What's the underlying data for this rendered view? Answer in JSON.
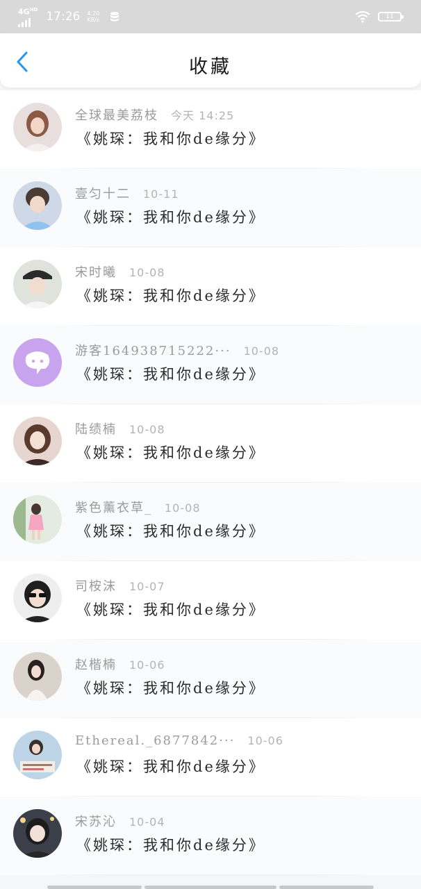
{
  "status_bar": {
    "network": "4G",
    "network_sup": "HD",
    "time": "17:26",
    "speed_value": "4.20",
    "speed_unit": "KB/s",
    "battery_text": "11"
  },
  "header": {
    "title": "收藏",
    "back_icon": "chevron-left-icon"
  },
  "favorites": [
    {
      "name": "全球最美荔枝",
      "date": "今天 14:25",
      "message": "《姚琛：我和你de缘分》"
    },
    {
      "name": "壹匀十二",
      "date": "10-11",
      "message": "《姚琛：我和你de缘分》"
    },
    {
      "name": "宋时曦",
      "date": "10-08",
      "message": "《姚琛：我和你de缘分》"
    },
    {
      "name": "游客164938715222···",
      "date": "10-08",
      "message": "《姚琛：我和你de缘分》"
    },
    {
      "name": "陆绩楠",
      "date": "10-08",
      "message": "《姚琛：我和你de缘分》"
    },
    {
      "name": "紫色薰衣草_",
      "date": "10-08",
      "message": "《姚琛：我和你de缘分》"
    },
    {
      "name": "司桉沫",
      "date": "10-07",
      "message": "《姚琛：我和你de缘分》"
    },
    {
      "name": "赵楷楠",
      "date": "10-06",
      "message": "《姚琛：我和你de缘分》"
    },
    {
      "name": "Ethereal._6877842···",
      "date": "10-06",
      "message": "《姚琛：我和你de缘分》"
    },
    {
      "name": "宋苏沁",
      "date": "10-04",
      "message": "《姚琛：我和你de缘分》"
    }
  ],
  "colors": {
    "accent": "#2196f3",
    "status_bar_bg": "#d9d9d9",
    "guest_avatar": "#c9a4ee"
  }
}
